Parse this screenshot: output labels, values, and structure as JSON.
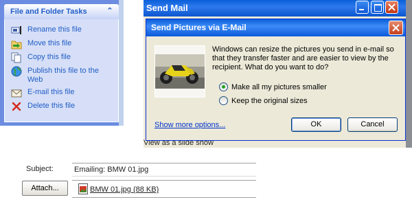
{
  "task_pane": {
    "title": "File and Folder Tasks",
    "collapse_icon": "chevron-up-double-icon",
    "items": [
      {
        "label": "Rename this file",
        "icon": "rename-icon"
      },
      {
        "label": "Move this file",
        "icon": "move-icon"
      },
      {
        "label": "Copy this file",
        "icon": "copy-icon"
      },
      {
        "label": "Publish this file to the Web",
        "icon": "publish-web-icon"
      },
      {
        "label": "E-mail this file",
        "icon": "email-icon"
      },
      {
        "label": "Delete this file",
        "icon": "delete-icon"
      }
    ]
  },
  "send_mail": {
    "title": "Send Mail",
    "slideshow_text": "View as a slide show"
  },
  "dialog": {
    "title": "Send Pictures via E-Mail",
    "message": "Windows can resize the pictures you send in e-mail so that they transfer faster and are easier to view by the recipient.  What do you want to do?",
    "options": [
      {
        "label": "Make all my pictures smaller",
        "selected": true
      },
      {
        "label": "Keep the original sizes",
        "selected": false
      }
    ],
    "show_more_link": "Show more options...",
    "ok_label": "OK",
    "cancel_label": "Cancel"
  },
  "compose": {
    "subject_label": "Subject:",
    "subject_value": "Emailing: BMW 01.jpg",
    "attach_label": "Attach...",
    "attachment_name": "BMW 01.jpg (88 KB)"
  },
  "colors": {
    "xp_blue": "#0a5fd8",
    "task_link": "#215dc6",
    "close_red": "#c4401c"
  }
}
